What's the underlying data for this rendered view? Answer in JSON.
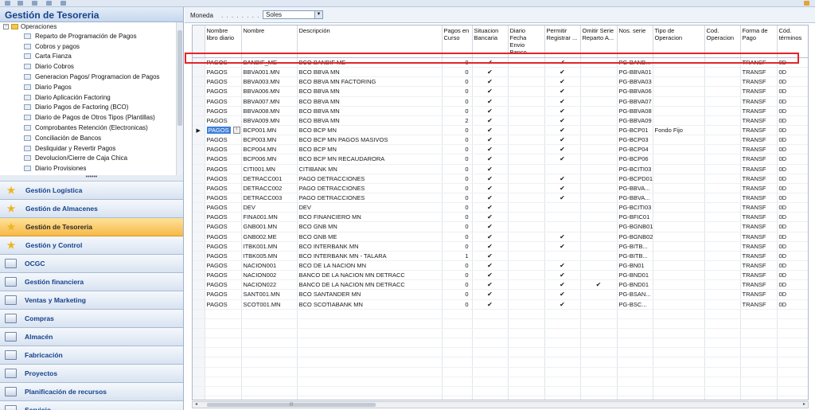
{
  "nav": {
    "title": "Gestión de Tesoreria",
    "tree_root": "Operaciones",
    "tree_items": [
      "Reparto de Programación de Pagos",
      "Cobros y pagos",
      "Carta Fianza",
      "Diario Cobros",
      "Generacion Pagos/ Programacion de Pagos",
      "Diario Pagos",
      "Diario Aplicación Factoring",
      "Diario Pagos de Factoring (BCO)",
      "Diario de Pagos de Otros Tipos (Plantillas)",
      "Comprobantes Retención (Electronicas)",
      "Conciliación de Bancos",
      "Desliquidar y Revertir Pagos",
      "Devolucion/Cierre de  Caja Chica",
      "Diario Provisiones"
    ],
    "splitter": "••••••",
    "modules": [
      {
        "label": "Gestión Logística",
        "icon": "star-icon",
        "active": false
      },
      {
        "label": "Gestión de Almacenes",
        "icon": "star-icon",
        "active": false
      },
      {
        "label": "Gestión de Tesoreria",
        "icon": "star-icon",
        "active": true
      },
      {
        "label": "Gestión y Control",
        "icon": "star-icon",
        "active": false
      },
      {
        "label": "OCGC",
        "icon": "module-icon",
        "active": false
      },
      {
        "label": "Gestión financiera",
        "icon": "module-icon",
        "active": false
      },
      {
        "label": "Ventas y Marketing",
        "icon": "module-icon",
        "active": false
      },
      {
        "label": "Compras",
        "icon": "module-icon",
        "active": false
      },
      {
        "label": "Almacén",
        "icon": "module-icon",
        "active": false
      },
      {
        "label": "Fabricación",
        "icon": "module-icon",
        "active": false
      },
      {
        "label": "Proyectos",
        "icon": "module-icon",
        "active": false
      },
      {
        "label": "Planificación de recursos",
        "icon": "module-icon",
        "active": false
      },
      {
        "label": "Servicio",
        "icon": "module-icon",
        "active": false
      }
    ]
  },
  "filter": {
    "label": "Moneda",
    "dots": ". . . . . . . . .",
    "value": "Soles"
  },
  "grid": {
    "columns": [
      "Nombre libro diario",
      "Nombre",
      "Descripción",
      "Pagos en Curso",
      "Situacion Bancaria",
      "Diario Fecha Envio Banco",
      "Permitir Registrar ...",
      "Omitir Serie Reparto A...",
      "Nos. serie",
      "Tipo de Operacion",
      "Cod. Operacion",
      "Forma de Pago",
      "Cód. términos"
    ],
    "check_glyph": "✔",
    "current_row_glyph": "▶",
    "rows": [
      {
        "libro": "PAGOS",
        "nombre": "BANBIF_ME",
        "desc": "BCO BANBIF ME",
        "curso": "0",
        "sit": true,
        "env": false,
        "perm": true,
        "omit": false,
        "serie": "PG-BANB...",
        "tipo": "",
        "cod": "",
        "forma": "TRANSF",
        "term": "0D"
      },
      {
        "libro": "PAGOS",
        "nombre": "BBVA001.MN",
        "desc": "BCO BBVA MN",
        "curso": "0",
        "sit": true,
        "env": false,
        "perm": true,
        "omit": false,
        "serie": "PG-BBVA01",
        "tipo": "",
        "cod": "",
        "forma": "TRANSF",
        "term": "0D"
      },
      {
        "libro": "PAGOS",
        "nombre": "BBVA003.MN",
        "desc": "BCO BBVA MN FACTORING",
        "curso": "0",
        "sit": true,
        "env": false,
        "perm": true,
        "omit": false,
        "serie": "PG-BBVA03",
        "tipo": "",
        "cod": "",
        "forma": "TRANSF",
        "term": "0D"
      },
      {
        "libro": "PAGOS",
        "nombre": "BBVA006.MN",
        "desc": "BCO BBVA MN",
        "curso": "0",
        "sit": true,
        "env": false,
        "perm": true,
        "omit": false,
        "serie": "PG-BBVA06",
        "tipo": "",
        "cod": "",
        "forma": "TRANSF",
        "term": "0D"
      },
      {
        "libro": "PAGOS",
        "nombre": "BBVA007.MN",
        "desc": "BCO BBVA MN",
        "curso": "0",
        "sit": true,
        "env": false,
        "perm": true,
        "omit": false,
        "serie": "PG-BBVA07",
        "tipo": "",
        "cod": "",
        "forma": "TRANSF",
        "term": "0D"
      },
      {
        "libro": "PAGOS",
        "nombre": "BBVA008.MN",
        "desc": "BCO BBVA MN",
        "curso": "0",
        "sit": true,
        "env": false,
        "perm": true,
        "omit": false,
        "serie": "PG-BBVA08",
        "tipo": "",
        "cod": "",
        "forma": "TRANSF",
        "term": "0D"
      },
      {
        "libro": "PAGOS",
        "nombre": "BBVA009.MN",
        "desc": "BCO BBVA MN",
        "curso": "2",
        "sit": true,
        "env": false,
        "perm": true,
        "omit": false,
        "serie": "PG-BBVA09",
        "tipo": "",
        "cod": "",
        "forma": "TRANSF",
        "term": "0D"
      },
      {
        "libro": "PAGOS",
        "nombre": "BCP001.MN",
        "desc": "BCO BCP MN",
        "curso": "0",
        "sit": true,
        "env": false,
        "perm": true,
        "omit": false,
        "serie": "PG-BCP01",
        "tipo": "Fondo Fijo",
        "cod": "",
        "forma": "TRANSF",
        "term": "0D",
        "current": true
      },
      {
        "libro": "PAGOS",
        "nombre": "BCP003.MN",
        "desc": "BCO BCP MN PAGOS MASIVOS",
        "curso": "0",
        "sit": true,
        "env": false,
        "perm": true,
        "omit": false,
        "serie": "PG-BCP03",
        "tipo": "",
        "cod": "",
        "forma": "TRANSF",
        "term": "0D"
      },
      {
        "libro": "PAGOS",
        "nombre": "BCP004.MN",
        "desc": "BCO BCP MN",
        "curso": "0",
        "sit": true,
        "env": false,
        "perm": true,
        "omit": false,
        "serie": "PG-BCP04",
        "tipo": "",
        "cod": "",
        "forma": "TRANSF",
        "term": "0D"
      },
      {
        "libro": "PAGOS",
        "nombre": "BCP006.MN",
        "desc": "BCO BCP MN RECAUDARORA",
        "curso": "0",
        "sit": true,
        "env": false,
        "perm": true,
        "omit": false,
        "serie": "PG-BCP06",
        "tipo": "",
        "cod": "",
        "forma": "TRANSF",
        "term": "0D"
      },
      {
        "libro": "PAGOS",
        "nombre": "CITI001.MN",
        "desc": "CITIBANK MN",
        "curso": "0",
        "sit": true,
        "env": false,
        "perm": false,
        "omit": false,
        "serie": "PG-BCITI03",
        "tipo": "",
        "cod": "",
        "forma": "TRANSF",
        "term": "0D"
      },
      {
        "libro": "PAGOS",
        "nombre": "DETRACC001",
        "desc": "PAGO DETRACCIONES",
        "curso": "0",
        "sit": true,
        "env": false,
        "perm": true,
        "omit": false,
        "serie": "PG-BCPD01",
        "tipo": "",
        "cod": "",
        "forma": "TRANSF",
        "term": "0D"
      },
      {
        "libro": "PAGOS",
        "nombre": "DETRACC002",
        "desc": "PAGO DETRACCIONES",
        "curso": "0",
        "sit": true,
        "env": false,
        "perm": true,
        "omit": false,
        "serie": "PG-BBVA...",
        "tipo": "",
        "cod": "",
        "forma": "TRANSF",
        "term": "0D"
      },
      {
        "libro": "PAGOS",
        "nombre": "DETRACC003",
        "desc": "PAGO DETRACCIONES",
        "curso": "0",
        "sit": true,
        "env": false,
        "perm": true,
        "omit": false,
        "serie": "PG-BBVA...",
        "tipo": "",
        "cod": "",
        "forma": "TRANSF",
        "term": "0D"
      },
      {
        "libro": "PAGOS",
        "nombre": "DEV",
        "desc": "DEV",
        "curso": "0",
        "sit": true,
        "env": false,
        "perm": false,
        "omit": false,
        "serie": "PG-BCITI03",
        "tipo": "",
        "cod": "",
        "forma": "TRANSF",
        "term": "0D"
      },
      {
        "libro": "PAGOS",
        "nombre": "FINA001.MN",
        "desc": "BCO FINANCIERO MN",
        "curso": "0",
        "sit": true,
        "env": false,
        "perm": false,
        "omit": false,
        "serie": "PG-BFIC01",
        "tipo": "",
        "cod": "",
        "forma": "TRANSF",
        "term": "0D"
      },
      {
        "libro": "PAGOS",
        "nombre": "GNB001.MN",
        "desc": "BCO GNB MN",
        "curso": "0",
        "sit": true,
        "env": false,
        "perm": false,
        "omit": false,
        "serie": "PG-BGNB01",
        "tipo": "",
        "cod": "",
        "forma": "TRANSF",
        "term": "0D"
      },
      {
        "libro": "PAGOS",
        "nombre": "GNB002.ME",
        "desc": "BCO GNB ME",
        "curso": "0",
        "sit": true,
        "env": false,
        "perm": true,
        "omit": false,
        "serie": "PG-BGNB02",
        "tipo": "",
        "cod": "",
        "forma": "TRANSF",
        "term": "0D"
      },
      {
        "libro": "PAGOS",
        "nombre": "ITBK001.MN",
        "desc": "BCO INTERBANK MN",
        "curso": "0",
        "sit": true,
        "env": false,
        "perm": true,
        "omit": false,
        "serie": "PG-BITB...",
        "tipo": "",
        "cod": "",
        "forma": "TRANSF",
        "term": "0D"
      },
      {
        "libro": "PAGOS",
        "nombre": "ITBK005.MN",
        "desc": "BCO INTERBANK MN - TALARA",
        "curso": "1",
        "sit": true,
        "env": false,
        "perm": false,
        "omit": false,
        "serie": "PG-BITB...",
        "tipo": "",
        "cod": "",
        "forma": "TRANSF",
        "term": "0D"
      },
      {
        "libro": "PAGOS",
        "nombre": "NACION001",
        "desc": "BCO DE LA NACION MN",
        "curso": "0",
        "sit": true,
        "env": false,
        "perm": true,
        "omit": false,
        "serie": "PG-BN01",
        "tipo": "",
        "cod": "",
        "forma": "TRANSF",
        "term": "0D"
      },
      {
        "libro": "PAGOS",
        "nombre": "NACION002",
        "desc": "BANCO DE LA NACION MN DETRACC",
        "curso": "0",
        "sit": true,
        "env": false,
        "perm": true,
        "omit": false,
        "serie": "PG-BND01",
        "tipo": "",
        "cod": "",
        "forma": "TRANSF",
        "term": "0D"
      },
      {
        "libro": "PAGOS",
        "nombre": "NACION022",
        "desc": "BANCO DE LA NACION MN DETRACC",
        "curso": "0",
        "sit": true,
        "env": false,
        "perm": true,
        "omit": true,
        "serie": "PG-BND01",
        "tipo": "",
        "cod": "",
        "forma": "TRANSF",
        "term": "0D"
      },
      {
        "libro": "PAGOS",
        "nombre": "SANT001.MN",
        "desc": "BCO SANTANDER MN",
        "curso": "0",
        "sit": true,
        "env": false,
        "perm": true,
        "omit": false,
        "serie": "PG-BSAN...",
        "tipo": "",
        "cod": "",
        "forma": "TRANSF",
        "term": "0D"
      },
      {
        "libro": "PAGOS",
        "nombre": "SCOT001.MN",
        "desc": "BCO SCOTIABANK MN",
        "curso": "0",
        "sit": true,
        "env": false,
        "perm": true,
        "omit": false,
        "serie": "PG-BSC...",
        "tipo": "",
        "cod": "",
        "forma": "TRANSF",
        "term": "0D"
      }
    ],
    "empty_rows": 12
  },
  "scroll": {
    "left": "◂",
    "right": "▸",
    "grip": "|||"
  },
  "colors": {
    "accent": "#15428b",
    "active_module": "#f7b948",
    "highlight": "#e3242b",
    "selection": "#3d7fd6"
  }
}
